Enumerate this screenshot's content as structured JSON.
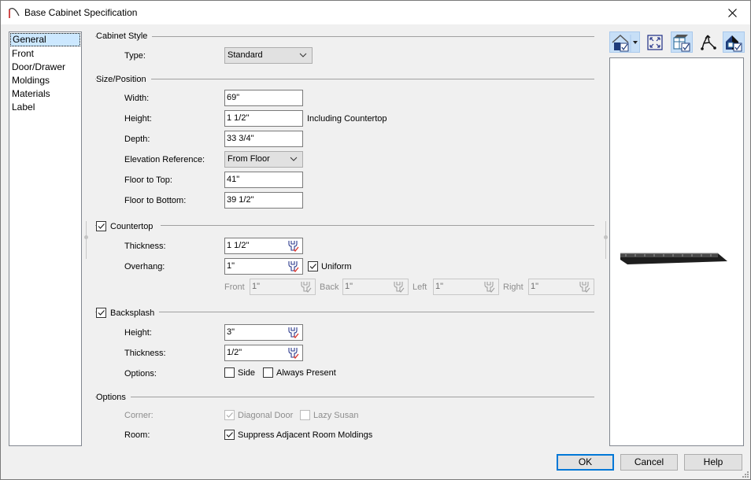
{
  "window": {
    "title": "Base Cabinet Specification",
    "icon": "arch-app-icon",
    "close_icon": "close-icon"
  },
  "nav": {
    "items": [
      {
        "label": "General",
        "selected": true
      },
      {
        "label": "Front",
        "selected": false
      },
      {
        "label": "Door/Drawer",
        "selected": false
      },
      {
        "label": "Moldings",
        "selected": false
      },
      {
        "label": "Materials",
        "selected": false
      },
      {
        "label": "Label",
        "selected": false
      }
    ]
  },
  "cabinet_style": {
    "title": "Cabinet Style",
    "type_label": "Type:",
    "type_value": "Standard"
  },
  "size_position": {
    "title": "Size/Position",
    "width_label": "Width:",
    "width_value": "69\"",
    "height_label": "Height:",
    "height_value": "1 1/2\"",
    "height_note": "Including Countertop",
    "depth_label": "Depth:",
    "depth_value": "33 3/4\"",
    "elevation_label": "Elevation Reference:",
    "elevation_value": "From Floor",
    "floor_top_label": "Floor to Top:",
    "floor_top_value": "41\"",
    "floor_bottom_label": "Floor to Bottom:",
    "floor_bottom_value": "39 1/2\""
  },
  "countertop": {
    "title": "Countertop",
    "checked": true,
    "thickness_label": "Thickness:",
    "thickness_value": "1 1/2\"",
    "overhang_label": "Overhang:",
    "overhang_value": "1\"",
    "uniform_label": "Uniform",
    "uniform_checked": true,
    "front_label": "Front",
    "front_value": "1\"",
    "back_label": "Back",
    "back_value": "1\"",
    "left_label": "Left",
    "left_value": "1\"",
    "right_label": "Right",
    "right_value": "1\""
  },
  "backsplash": {
    "title": "Backsplash",
    "checked": true,
    "height_label": "Height:",
    "height_value": "3\"",
    "thickness_label": "Thickness:",
    "thickness_value": "1/2\"",
    "options_label": "Options:",
    "side_label": "Side",
    "side_checked": false,
    "always_label": "Always Present",
    "always_checked": false
  },
  "options": {
    "title": "Options",
    "corner_label": "Corner:",
    "diagonal_label": "Diagonal Door",
    "diagonal_checked": true,
    "diagonal_disabled": true,
    "lazy_label": "Lazy Susan",
    "lazy_checked": false,
    "lazy_disabled": true,
    "room_label": "Room:",
    "suppress_label": "Suppress Adjacent Room Moldings",
    "suppress_checked": true
  },
  "toolbar": {
    "icons": [
      "view-mode-icon",
      "fit-view-icon",
      "show-cabinet-icon",
      "orbit-icon",
      "color-view-icon"
    ]
  },
  "buttons": {
    "ok": "OK",
    "cancel": "Cancel",
    "help": "Help"
  },
  "colors": {
    "accent": "#0078d7",
    "selection": "#cce8ff",
    "toolbar_active": "#c7dff7"
  }
}
